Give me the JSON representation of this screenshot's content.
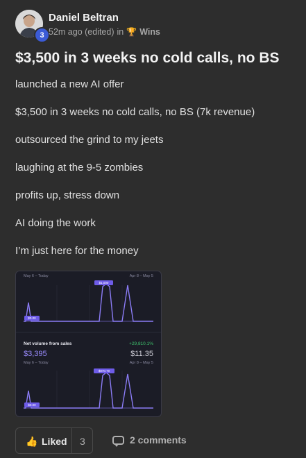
{
  "author": {
    "name": "Daniel Beltran",
    "level": "3",
    "time": "52m ago (edited)",
    "in_label": "in",
    "category_icon": "trophy-icon",
    "category": "Wins"
  },
  "post": {
    "title": "$3,500 in 3 weeks no cold calls, no BS",
    "lines": [
      "launched a new AI offer",
      "$3,500 in 3 weeks no cold calls, no BS (7k revenue)",
      "outsourced the grind to my jeets",
      "laughing at the 9-5 zombies",
      "profits up, stress down",
      "AI doing the work",
      "I’m just here for the money"
    ]
  },
  "dashboard": {
    "top": {
      "range_left": "May 6 – Today",
      "range_right": "Apr 8 – May 5",
      "peak_label": "$1,000",
      "base_label": "$0.00"
    },
    "bottom": {
      "title": "Net volume from sales",
      "change": "+29,810.1%",
      "value_now": "$3,395",
      "value_prev": "$11.35",
      "range_left": "May 6 – Today",
      "range_right": "Apr 8 – May 5",
      "peak_label": "$970.70",
      "base_label": "$0.00"
    },
    "colors": {
      "line": "#8b7cf6",
      "positive": "#3ec46d",
      "bg": "#1b1c26"
    }
  },
  "actions": {
    "like_icon": "thumbs-up-icon",
    "like_label": "Liked",
    "like_count": "3",
    "comment_icon": "comment-icon",
    "comments_label": "2 comments"
  }
}
